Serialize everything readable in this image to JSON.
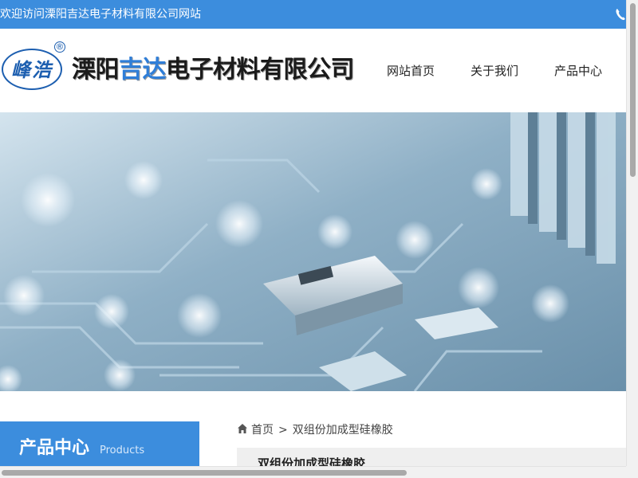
{
  "topbar": {
    "welcome": "欢迎访问溧阳吉达电子材料有限公司网站",
    "phone_icon": "phone-icon"
  },
  "header": {
    "logo_text": "峰浩",
    "logo_reg": "®",
    "company_part1": "溧阳",
    "company_accent": "吉达",
    "company_part2": "电子材料有限公司",
    "accent_color": "#2f7ed8"
  },
  "nav": {
    "items": [
      "网站首页",
      "关于我们",
      "产品中心"
    ]
  },
  "banner": {
    "image": "circuit-board-photo"
  },
  "sidebar": {
    "title": "产品中心",
    "subtitle": "Products"
  },
  "breadcrumb": {
    "home": "首页",
    "separator": ">",
    "current": "双组份加成型硅橡胶"
  },
  "product": {
    "title": "双组份加成型硅橡胶"
  },
  "colors": {
    "primary": "#3c8ddd",
    "text": "#222222"
  }
}
